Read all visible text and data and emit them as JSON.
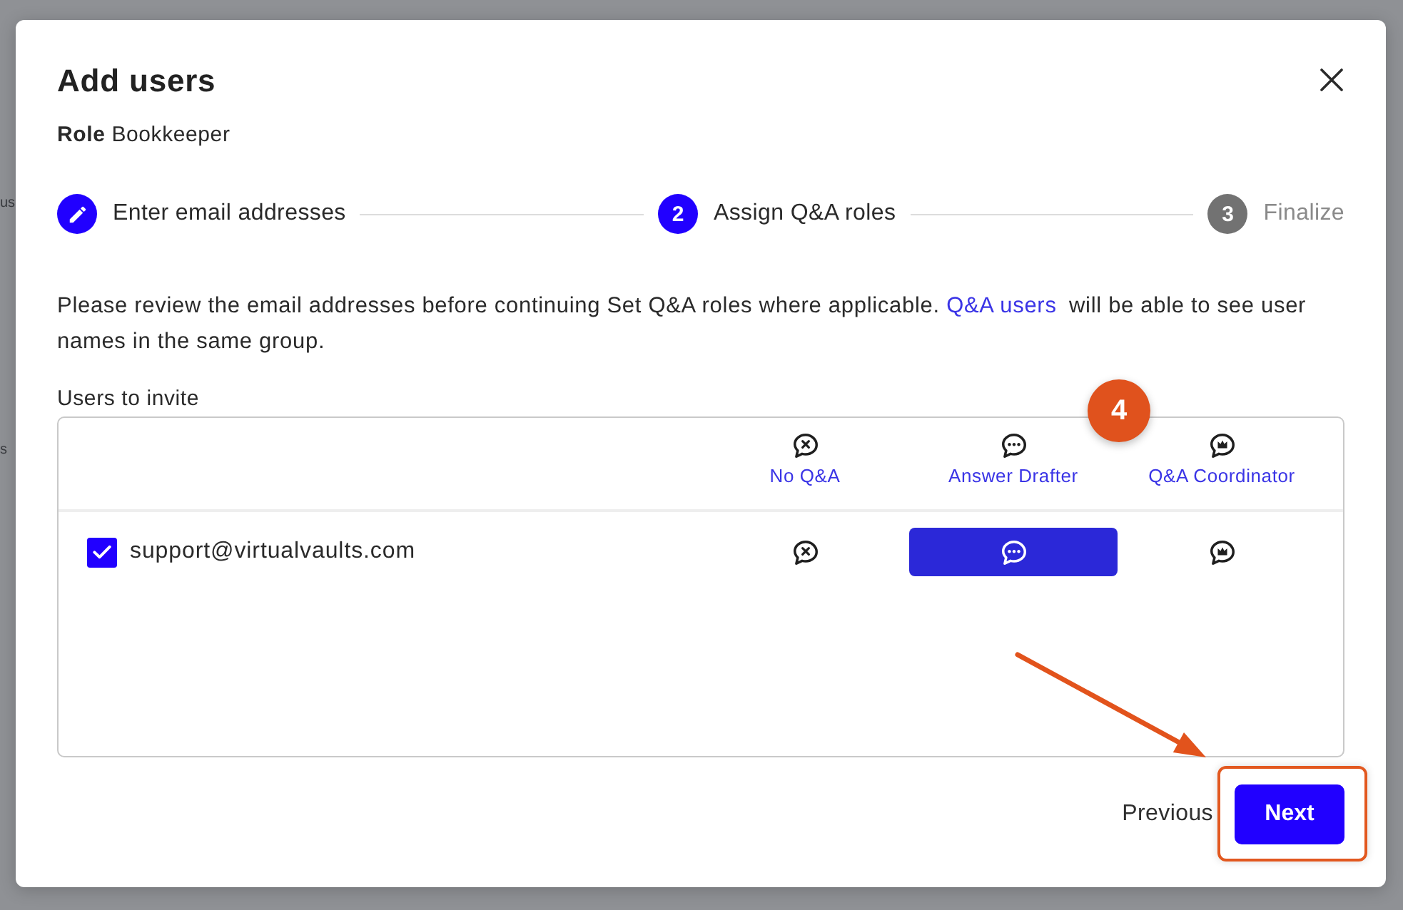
{
  "background": {
    "texts": [
      "us",
      "s"
    ]
  },
  "dialog": {
    "title": "Add users",
    "role_label": "Role",
    "role_value": "Bookkeeper"
  },
  "steps": [
    {
      "label": "Enter email addresses",
      "completed": true,
      "selected": false
    },
    {
      "number": "2",
      "label": "Assign Q&A roles",
      "completed": false,
      "selected": true
    },
    {
      "number": "3",
      "label": "Finalize",
      "completed": false,
      "selected": false
    }
  ],
  "intro": {
    "text_before": "Please review the email addresses before continuing Set Q&A roles where applicable.",
    "link": "Q&A users",
    "text_after": "will be able to see user names in the same group."
  },
  "users_label": "Users to invite",
  "table": {
    "columns": [
      {
        "label": "No Q&A"
      },
      {
        "label": "Answer Drafter"
      },
      {
        "label": "Q&A Coordinator"
      }
    ],
    "rows": [
      {
        "email": "support@virtualvaults.com",
        "checked": true,
        "options": [
          {
            "selected": false
          },
          {
            "selected": true
          },
          {
            "selected": false
          }
        ]
      }
    ]
  },
  "footer": {
    "previous": "Previous",
    "next": "Next"
  },
  "annotations": [
    {
      "kind": "badge",
      "label": "4"
    },
    {
      "kind": "arrow"
    },
    {
      "kind": "highlight"
    }
  ]
}
